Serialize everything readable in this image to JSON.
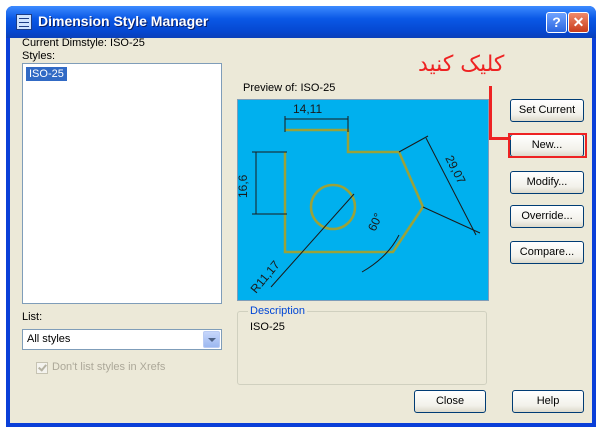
{
  "window": {
    "title": "Dimension Style Manager",
    "help_glyph": "?",
    "close_glyph": "✕"
  },
  "current_dimstyle": "Current Dimstyle: ISO-25",
  "styles_label": "Styles:",
  "styles": [
    "ISO-25"
  ],
  "preview_label": "Preview of: ISO-25",
  "preview_dims": {
    "top": "14,11",
    "left": "16,6",
    "angle": "60°",
    "right": "29,07",
    "radius": "R11,17"
  },
  "list_label": "List:",
  "list_selected": "All styles",
  "checkbox_label": "Don't list styles in Xrefs",
  "description_title": "Description",
  "description_value": "ISO-25",
  "buttons": {
    "set_current": "Set Current",
    "new": "New...",
    "modify": "Modify...",
    "override": "Override...",
    "compare": "Compare...",
    "close": "Close",
    "help": "Help"
  },
  "annotation": "کلیک کنید",
  "colors": {
    "titlebar": "#0a58e6",
    "preview_bg": "#00b0ee",
    "selection": "#316ac5",
    "annotation": "#ee2222",
    "drawing_lines": "#9aa23a"
  }
}
